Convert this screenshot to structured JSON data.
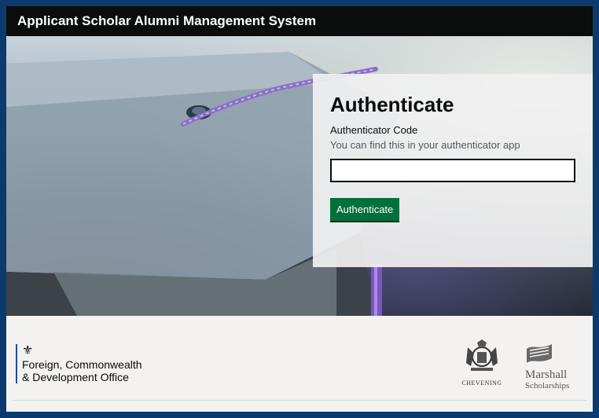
{
  "header": {
    "title": "Applicant Scholar Alumni Management System"
  },
  "auth": {
    "heading": "Authenticate",
    "code_label": "Authenticator Code",
    "code_hint": "You can find this in your authenticator app",
    "code_value": "",
    "code_placeholder": "",
    "submit_label": "Authenticate"
  },
  "footer": {
    "fcdo_line1": "Foreign, Commonwealth",
    "fcdo_line2": "& Development Office",
    "chevening": "CHEVENING",
    "marshall_line1": "Marshall",
    "marshall_line2": "Scholarships"
  },
  "icons": {
    "crest": "royal-arms-crest-icon",
    "marshall_flag": "marshall-flag-icon"
  },
  "colors": {
    "header_bg": "#0b0c0c",
    "button_bg": "#00703c",
    "frame_bg": "#0b3a6e",
    "footer_bg": "#f3f2f1"
  }
}
